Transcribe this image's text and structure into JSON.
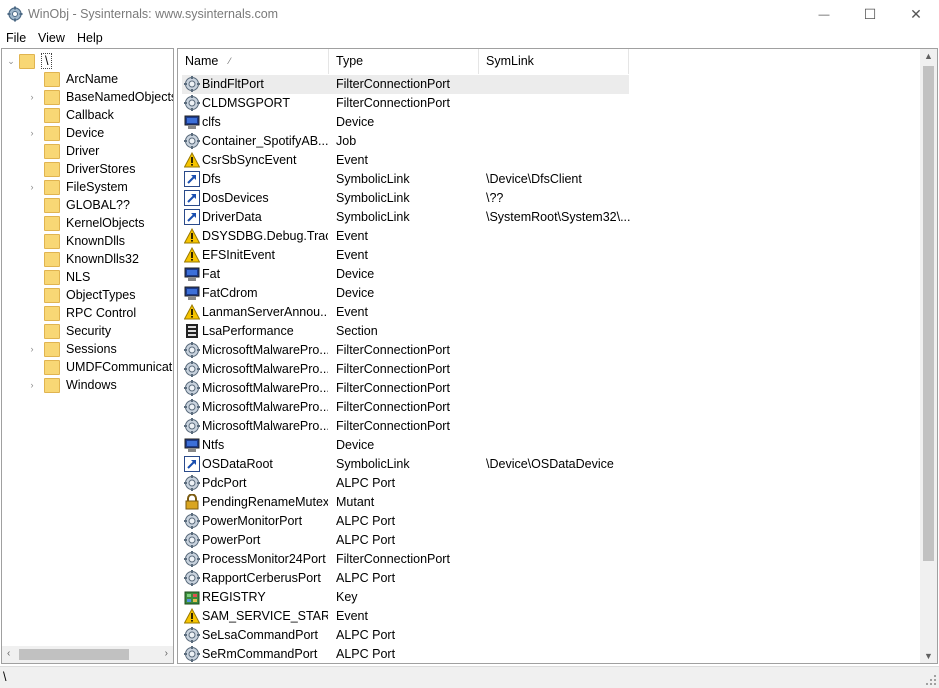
{
  "window": {
    "title": "WinObj - Sysinternals: www.sysinternals.com",
    "minimize": "—",
    "maximize": "☐",
    "close": "✕"
  },
  "menu": [
    "File",
    "View",
    "Help"
  ],
  "tree": {
    "root": "\\",
    "items": [
      {
        "label": "ArcName",
        "expandable": false
      },
      {
        "label": "BaseNamedObjects",
        "expandable": true
      },
      {
        "label": "Callback",
        "expandable": false
      },
      {
        "label": "Device",
        "expandable": true
      },
      {
        "label": "Driver",
        "expandable": false
      },
      {
        "label": "DriverStores",
        "expandable": false
      },
      {
        "label": "FileSystem",
        "expandable": true
      },
      {
        "label": "GLOBAL??",
        "expandable": false
      },
      {
        "label": "KernelObjects",
        "expandable": false
      },
      {
        "label": "KnownDlls",
        "expandable": false
      },
      {
        "label": "KnownDlls32",
        "expandable": false
      },
      {
        "label": "NLS",
        "expandable": false
      },
      {
        "label": "ObjectTypes",
        "expandable": false
      },
      {
        "label": "RPC Control",
        "expandable": false
      },
      {
        "label": "Security",
        "expandable": false
      },
      {
        "label": "Sessions",
        "expandable": true
      },
      {
        "label": "UMDFCommunicatio",
        "expandable": false
      },
      {
        "label": "Windows",
        "expandable": true
      }
    ]
  },
  "list": {
    "columns": {
      "name": "Name",
      "type": "Type",
      "symlink": "SymLink"
    },
    "sort_indicator": "⁄",
    "rows": [
      {
        "name": "BindFltPort",
        "type": "FilterConnectionPort",
        "symlink": "",
        "icon": "port-icon"
      },
      {
        "name": "CLDMSGPORT",
        "type": "FilterConnectionPort",
        "symlink": "",
        "icon": "port-icon"
      },
      {
        "name": "clfs",
        "type": "Device",
        "symlink": "",
        "icon": "device-icon"
      },
      {
        "name": "Container_SpotifyAB....",
        "type": "Job",
        "symlink": "",
        "icon": "port-icon"
      },
      {
        "name": "CsrSbSyncEvent",
        "type": "Event",
        "symlink": "",
        "icon": "event-icon"
      },
      {
        "name": "Dfs",
        "type": "SymbolicLink",
        "symlink": "\\Device\\DfsClient",
        "icon": "symlink-icon"
      },
      {
        "name": "DosDevices",
        "type": "SymbolicLink",
        "symlink": "\\??",
        "icon": "symlink-icon"
      },
      {
        "name": "DriverData",
        "type": "SymbolicLink",
        "symlink": "\\SystemRoot\\System32\\...",
        "icon": "symlink-icon"
      },
      {
        "name": "DSYSDBG.Debug.Trac...",
        "type": "Event",
        "symlink": "",
        "icon": "event-icon"
      },
      {
        "name": "EFSInitEvent",
        "type": "Event",
        "symlink": "",
        "icon": "event-icon"
      },
      {
        "name": "Fat",
        "type": "Device",
        "symlink": "",
        "icon": "device-icon"
      },
      {
        "name": "FatCdrom",
        "type": "Device",
        "symlink": "",
        "icon": "device-icon"
      },
      {
        "name": "LanmanServerAnnou...",
        "type": "Event",
        "symlink": "",
        "icon": "event-icon"
      },
      {
        "name": "LsaPerformance",
        "type": "Section",
        "symlink": "",
        "icon": "section-icon"
      },
      {
        "name": "MicrosoftMalwarePro...",
        "type": "FilterConnectionPort",
        "symlink": "",
        "icon": "port-icon"
      },
      {
        "name": "MicrosoftMalwarePro...",
        "type": "FilterConnectionPort",
        "symlink": "",
        "icon": "port-icon"
      },
      {
        "name": "MicrosoftMalwarePro...",
        "type": "FilterConnectionPort",
        "symlink": "",
        "icon": "port-icon"
      },
      {
        "name": "MicrosoftMalwarePro...",
        "type": "FilterConnectionPort",
        "symlink": "",
        "icon": "port-icon"
      },
      {
        "name": "MicrosoftMalwarePro...",
        "type": "FilterConnectionPort",
        "symlink": "",
        "icon": "port-icon"
      },
      {
        "name": "Ntfs",
        "type": "Device",
        "symlink": "",
        "icon": "device-icon"
      },
      {
        "name": "OSDataRoot",
        "type": "SymbolicLink",
        "symlink": "\\Device\\OSDataDevice",
        "icon": "symlink-icon"
      },
      {
        "name": "PdcPort",
        "type": "ALPC Port",
        "symlink": "",
        "icon": "port-icon"
      },
      {
        "name": "PendingRenameMutex",
        "type": "Mutant",
        "symlink": "",
        "icon": "mutant-icon"
      },
      {
        "name": "PowerMonitorPort",
        "type": "ALPC Port",
        "symlink": "",
        "icon": "port-icon"
      },
      {
        "name": "PowerPort",
        "type": "ALPC Port",
        "symlink": "",
        "icon": "port-icon"
      },
      {
        "name": "ProcessMonitor24Port",
        "type": "FilterConnectionPort",
        "symlink": "",
        "icon": "port-icon"
      },
      {
        "name": "RapportCerberusPort",
        "type": "ALPC Port",
        "symlink": "",
        "icon": "port-icon"
      },
      {
        "name": "REGISTRY",
        "type": "Key",
        "symlink": "",
        "icon": "key-icon"
      },
      {
        "name": "SAM_SERVICE_STARTED",
        "type": "Event",
        "symlink": "",
        "icon": "event-icon"
      },
      {
        "name": "SeLsaCommandPort",
        "type": "ALPC Port",
        "symlink": "",
        "icon": "port-icon"
      },
      {
        "name": "SeRmCommandPort",
        "type": "ALPC Port",
        "symlink": "",
        "icon": "port-icon"
      }
    ]
  },
  "status": {
    "path": "\\"
  }
}
